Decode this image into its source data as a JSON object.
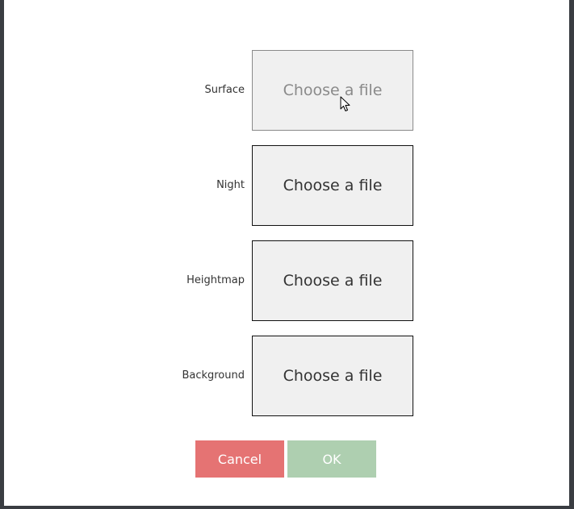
{
  "dialog": {
    "rows": [
      {
        "label": "Surface",
        "button_text": "Choose a file"
      },
      {
        "label": "Night",
        "button_text": "Choose a file"
      },
      {
        "label": "Heightmap",
        "button_text": "Choose a file"
      },
      {
        "label": "Background",
        "button_text": "Choose a file"
      }
    ],
    "cancel_label": "Cancel",
    "ok_label": "OK"
  },
  "colors": {
    "cancel": "#e57373",
    "ok": "#aecfb0",
    "box_background": "#f0f0f0"
  },
  "icons": {
    "cursor": "mouse-pointer-icon"
  }
}
